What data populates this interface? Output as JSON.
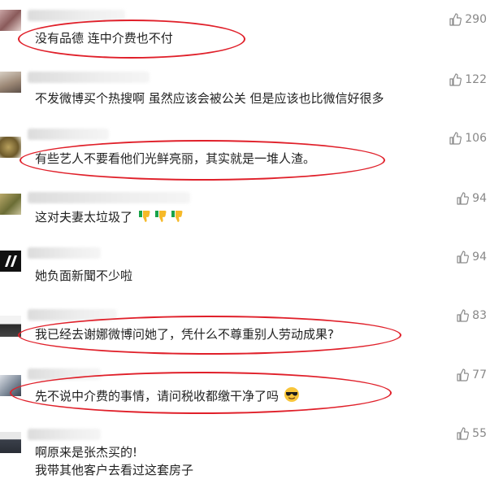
{
  "comments": [
    {
      "text": "没有品德  连中介费也不付",
      "likes": "290",
      "highlighted": true
    },
    {
      "text": "不发微博买个热搜啊  虽然应该会被公关  但是应该也比微信好很多",
      "likes": "122",
      "highlighted": false
    },
    {
      "text": "有些艺人不要看他们光鲜亮丽，其实就是一堆人渣。",
      "likes": "106",
      "highlighted": true
    },
    {
      "text": "这对夫妻太垃圾了",
      "likes": "94",
      "highlighted": false,
      "emoji": "thumbs-down-icon x3"
    },
    {
      "text": "她负面新聞不少啦",
      "likes": "94",
      "highlighted": false
    },
    {
      "text": "我已经去谢娜微博问她了，凭什么不尊重别人劳动成果?",
      "likes": "83",
      "highlighted": true
    },
    {
      "text": "先不说中介费的事情，请问税收都缴干净了吗",
      "likes": "77",
      "highlighted": true,
      "emoji": "sunglasses-face-icon"
    },
    {
      "text_lines": [
        "啊原来是张杰买的!",
        "我带其他客户去看过这套房子"
      ],
      "likes": "55",
      "highlighted": false
    }
  ],
  "colors": {
    "highlight_oval": "#e0202a",
    "like_text": "#888888",
    "comment_text": "#222222"
  }
}
